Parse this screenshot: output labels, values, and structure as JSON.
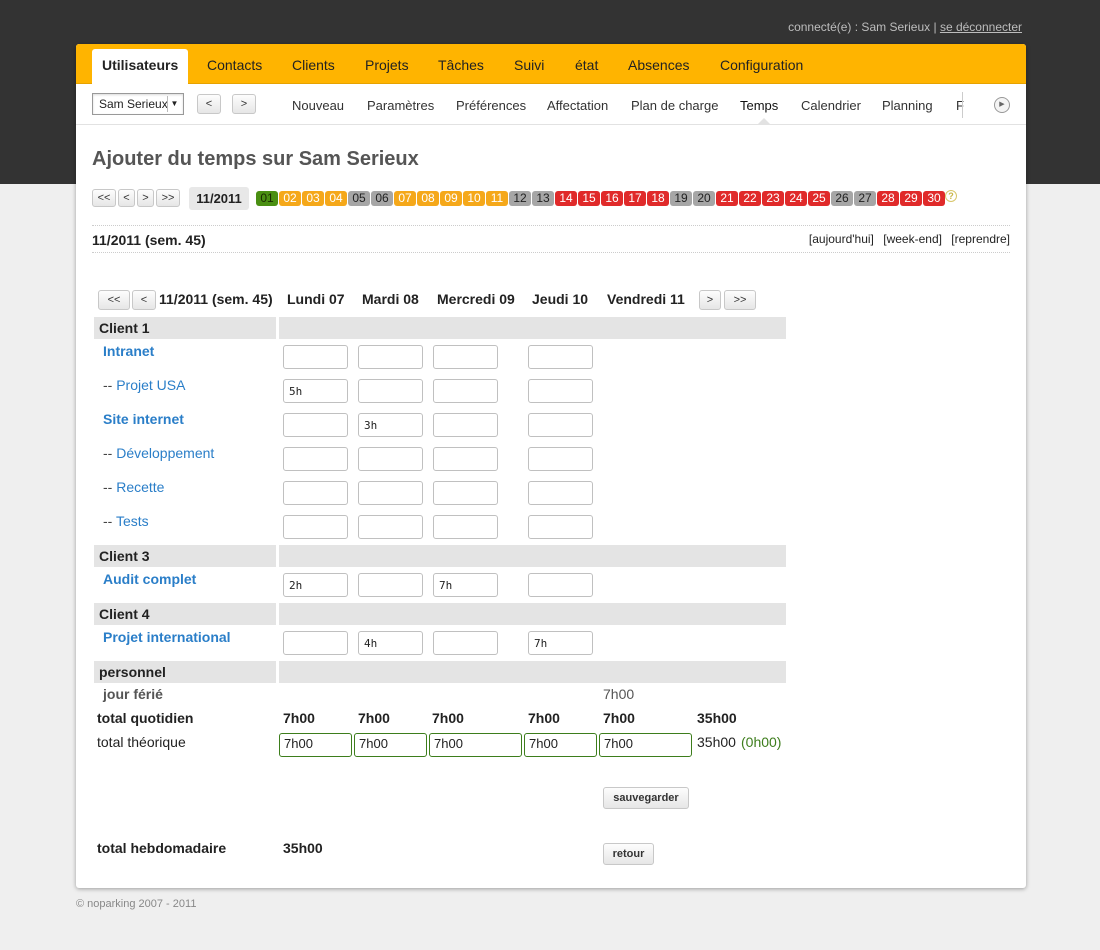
{
  "session": {
    "text": "connecté(e) : Sam Serieux |",
    "logout": "se déconnecter"
  },
  "main_nav": [
    "Utilisateurs",
    "Contacts",
    "Clients",
    "Projets",
    "Tâches",
    "Suivi",
    "état",
    "Absences",
    "Configuration"
  ],
  "sub_nav": {
    "user_select": "Sam Serieux",
    "prev": "<",
    "next": ">",
    "items": [
      "Nouveau",
      "Paramètres",
      "Préférences",
      "Affectation",
      "Plan de charge",
      "Temps",
      "Calendrier",
      "Planning",
      "F"
    ],
    "active": "Temps"
  },
  "page_title": "Ajouter du temps sur Sam Serieux",
  "period": {
    "nav": [
      "<<",
      "<",
      ">",
      ">>"
    ],
    "current": "11/2011",
    "weeks": [
      {
        "n": "01",
        "c": "green"
      },
      {
        "n": "02",
        "c": "orange"
      },
      {
        "n": "03",
        "c": "orange"
      },
      {
        "n": "04",
        "c": "orange"
      },
      {
        "n": "05",
        "c": "gray"
      },
      {
        "n": "06",
        "c": "gray"
      },
      {
        "n": "07",
        "c": "orange"
      },
      {
        "n": "08",
        "c": "orange"
      },
      {
        "n": "09",
        "c": "orange"
      },
      {
        "n": "10",
        "c": "orange"
      },
      {
        "n": "11",
        "c": "orange"
      },
      {
        "n": "12",
        "c": "gray"
      },
      {
        "n": "13",
        "c": "gray"
      },
      {
        "n": "14",
        "c": "red"
      },
      {
        "n": "15",
        "c": "red"
      },
      {
        "n": "16",
        "c": "red"
      },
      {
        "n": "17",
        "c": "red"
      },
      {
        "n": "18",
        "c": "red"
      },
      {
        "n": "19",
        "c": "gray"
      },
      {
        "n": "20",
        "c": "gray"
      },
      {
        "n": "21",
        "c": "red"
      },
      {
        "n": "22",
        "c": "red"
      },
      {
        "n": "23",
        "c": "red"
      },
      {
        "n": "24",
        "c": "red"
      },
      {
        "n": "25",
        "c": "red"
      },
      {
        "n": "26",
        "c": "gray"
      },
      {
        "n": "27",
        "c": "gray"
      },
      {
        "n": "28",
        "c": "red"
      },
      {
        "n": "29",
        "c": "red"
      },
      {
        "n": "30",
        "c": "red"
      }
    ],
    "help": "?"
  },
  "week_header": {
    "label": "11/2011 (sem. 45)",
    "links": [
      "[aujourd'hui]",
      "[week-end]",
      "[reprendre]"
    ]
  },
  "grid": {
    "nav_prev2": "<<",
    "nav_prev": "<",
    "nav_next": ">",
    "nav_next2": ">>",
    "week_label": "11/2011 (sem. 45)",
    "days": [
      "Lundi 07",
      "Mardi 08",
      "Mercredi 09",
      "Jeudi 10",
      "Vendredi 11"
    ],
    "clients": [
      {
        "name": "Client 1",
        "projects": [
          {
            "prefix": "",
            "name": "Intranet",
            "bold": true,
            "values": [
              "",
              "",
              "",
              ""
            ]
          },
          {
            "prefix": "-- ",
            "name": "Projet USA",
            "bold": false,
            "values": [
              "5h",
              "",
              "",
              ""
            ]
          },
          {
            "prefix": "",
            "name": "Site internet",
            "bold": true,
            "values": [
              "",
              "3h",
              "",
              ""
            ]
          },
          {
            "prefix": "-- ",
            "name": "Développement",
            "bold": false,
            "values": [
              "",
              "",
              "",
              ""
            ]
          },
          {
            "prefix": "-- ",
            "name": "Recette",
            "bold": false,
            "values": [
              "",
              "",
              "",
              ""
            ]
          },
          {
            "prefix": "-- ",
            "name": "Tests",
            "bold": false,
            "values": [
              "",
              "",
              "",
              ""
            ]
          }
        ]
      },
      {
        "name": "Client 3",
        "projects": [
          {
            "prefix": "",
            "name": "Audit complet",
            "bold": true,
            "values": [
              "2h",
              "",
              "7h",
              ""
            ]
          }
        ]
      },
      {
        "name": "Client 4",
        "projects": [
          {
            "prefix": "",
            "name": "Projet international",
            "bold": true,
            "values": [
              "",
              "4h",
              "",
              "7h"
            ]
          }
        ]
      }
    ],
    "personnel": {
      "name": "personnel",
      "holiday_label": "jour férié",
      "holiday_value": "7h00"
    },
    "total_quotidien": {
      "label": "total quotidien",
      "values": [
        "7h00",
        "7h00",
        "7h00",
        "7h00",
        "7h00"
      ],
      "sum": "35h00"
    },
    "total_theorique": {
      "label": "total théorique",
      "values": [
        "7h00",
        "7h00",
        "7h00",
        "7h00",
        "7h00"
      ],
      "sum": "35h00",
      "diff": "(0h00)"
    },
    "save_label": "sauvegarder",
    "weekly_label": "total hebdomadaire",
    "weekly_value": "35h00",
    "back_label": "retour"
  },
  "footer": "© noparking 2007 - 2011",
  "colors": {
    "header_bg": "#333333",
    "nav": "#ffb400",
    "link": "#2a7ec8",
    "ok": "#3d7d1c"
  }
}
